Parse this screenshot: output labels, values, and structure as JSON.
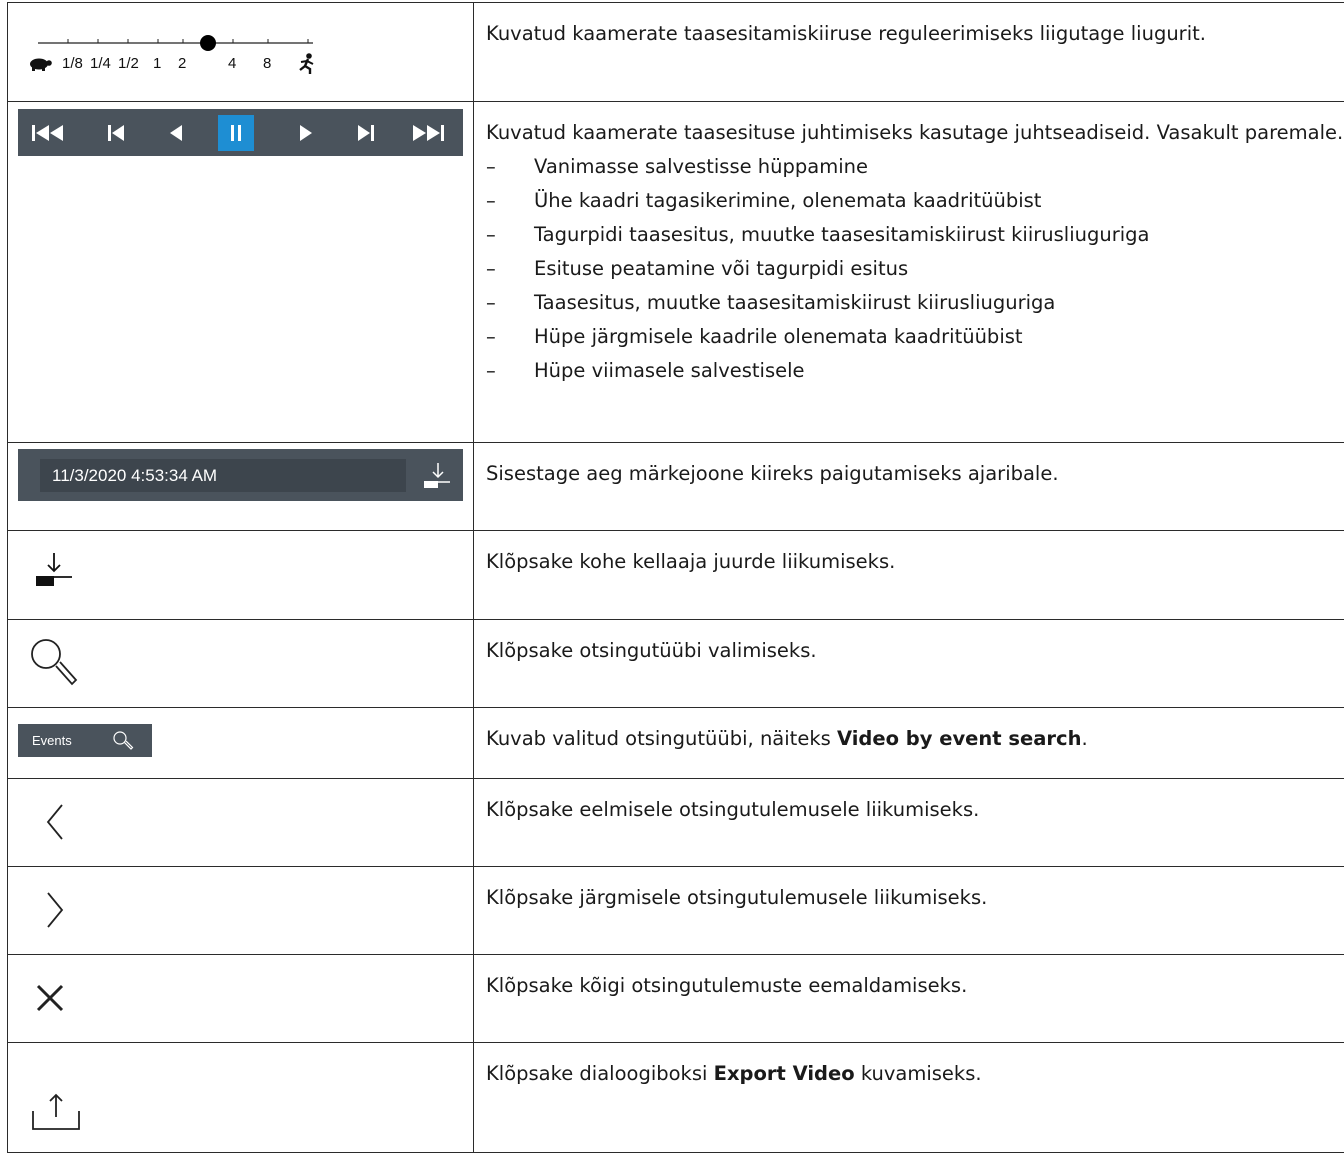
{
  "speed_slider": {
    "labels": [
      "1/8",
      "1/4",
      "1/2",
      "1",
      "2",
      "4",
      "8"
    ],
    "icons": [
      "turtle-icon",
      "running-person-icon"
    ]
  },
  "playback_toolbar": {
    "buttons": [
      "skip-to-start-icon",
      "step-back-icon",
      "play-reverse-icon",
      "pause-icon",
      "play-icon",
      "step-forward-icon",
      "skip-to-end-icon"
    ],
    "active_color": "#1e8ed3",
    "bar_color": "#4a535c"
  },
  "time_bar": {
    "value": "11/3/2020 4:53:34 AM"
  },
  "events_button": {
    "label": "Events"
  },
  "rows": {
    "r1": {
      "text": "Kuvatud kaamerate taasesitamiskiiruse reguleerimiseks liigutage liugurit."
    },
    "r2": {
      "intro": "Kuvatud kaamerate taasesituse juhtimiseks kasutage juhtseadiseid. Vasakult paremale.",
      "dash": "–",
      "bullets": [
        "Vanimasse salvestisse hüppamine",
        "Ühe kaadri tagasikerimine, olenemata kaadritüübist",
        "Tagurpidi taasesitus, muutke taasesitamiskiirust kiirusliuguriga",
        "Esituse peatamine või tagurpidi esitus",
        "Taasesitus, muutke taasesitamiskiirust kiirusliuguriga",
        "Hüpe järgmisele kaadrile olenemata kaadritüübist",
        "Hüpe viimasele salvestisele"
      ]
    },
    "r3": {
      "text": "Sisestage aeg märkejoone kiireks paigutamiseks ajaribale."
    },
    "r4": {
      "text": "Klõpsake kohe kellaaja juurde liikumiseks."
    },
    "r5": {
      "text": "Klõpsake otsingutüübi valimiseks."
    },
    "r6": {
      "pre": "Kuvab valitud otsingutüübi, näiteks ",
      "bold": "Video by event search",
      "post": "."
    },
    "r7": {
      "text": "Klõpsake eelmisele otsingutulemusele liikumiseks."
    },
    "r8": {
      "text": "Klõpsake järgmisele otsingutulemusele liikumiseks."
    },
    "r9": {
      "text": "Klõpsake kõigi otsingutulemuste eemaldamiseks."
    },
    "r10": {
      "pre": "Klõpsake dialoogiboksi ",
      "bold": "Export Video",
      "post": " kuvamiseks."
    }
  }
}
